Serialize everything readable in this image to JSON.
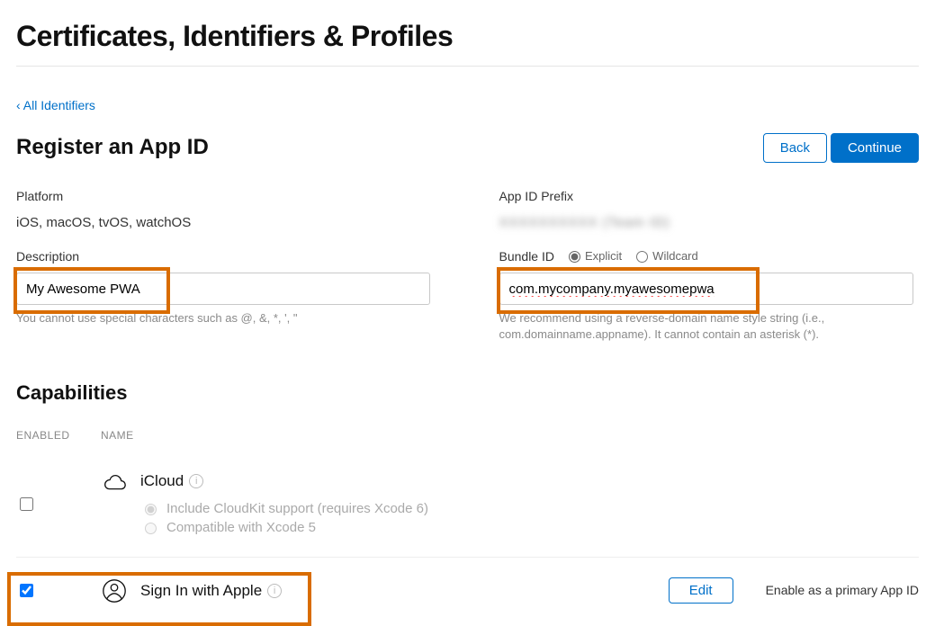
{
  "page": {
    "title": "Certificates, Identifiers & Profiles",
    "back_link": "All Identifiers",
    "section_title": "Register an App ID",
    "back_button": "Back",
    "continue_button": "Continue"
  },
  "form": {
    "platform": {
      "label": "Platform",
      "value": "iOS, macOS, tvOS, watchOS"
    },
    "app_id_prefix": {
      "label": "App ID Prefix",
      "value": "XXXXXXXXXX (Team ID)"
    },
    "description": {
      "label": "Description",
      "value": "My Awesome PWA",
      "helper": "You cannot use special characters such as @, &, *, ', \""
    },
    "bundle_id": {
      "label": "Bundle ID",
      "options": {
        "explicit": "Explicit",
        "wildcard": "Wildcard"
      },
      "selected": "explicit",
      "value": "com.mycompany.myawesomepwa",
      "helper": "We recommend using a reverse-domain name style string (i.e., com.domainname.appname). It cannot contain an asterisk (*)."
    }
  },
  "capabilities": {
    "title": "Capabilities",
    "columns": {
      "enabled": "ENABLED",
      "name": "NAME"
    },
    "items": [
      {
        "id": "icloud",
        "label": "iCloud",
        "checked": false,
        "sub_options": [
          {
            "label": "Include CloudKit support (requires Xcode 6)",
            "selected": true
          },
          {
            "label": "Compatible with Xcode 5",
            "selected": false
          }
        ]
      },
      {
        "id": "sign-in-with-apple",
        "label": "Sign In with Apple",
        "checked": true,
        "edit_button": "Edit",
        "side_text": "Enable as a primary App ID"
      }
    ]
  }
}
